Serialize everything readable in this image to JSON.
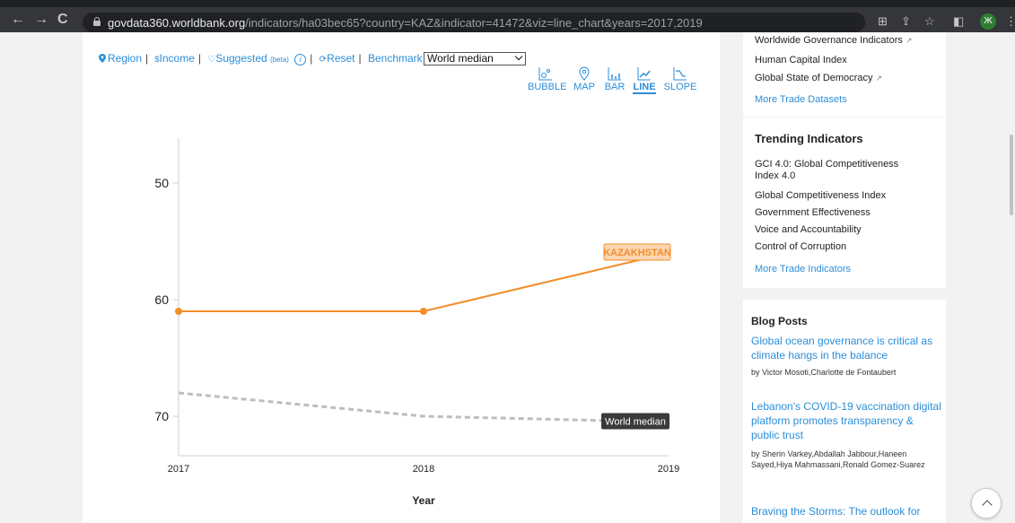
{
  "browser": {
    "url_domain": "govdata360.worldbank.org",
    "url_path": "/indicators/ha03bec65?country=KAZ&indicator=41472&viz=line_chart&years=2017,2019",
    "profile_initial": "Ж"
  },
  "filters": {
    "region": "Region",
    "income": "Income",
    "suggested": "Suggested",
    "beta": "(beta)",
    "info": "i",
    "reset": "Reset",
    "benchmark": "Benchmark",
    "benchmark_value": "World median"
  },
  "viz_tabs": [
    {
      "label": "BUBBLE",
      "icon": "bubble-chart-icon"
    },
    {
      "label": "MAP",
      "icon": "map-pin-icon"
    },
    {
      "label": "BAR",
      "icon": "bar-chart-icon"
    },
    {
      "label": "LINE",
      "icon": "line-chart-icon",
      "active": true
    },
    {
      "label": "SLOPE",
      "icon": "slope-chart-icon"
    }
  ],
  "chart_data": {
    "type": "line",
    "x": [
      2017,
      2018,
      2019
    ],
    "xlabel": "Year",
    "ylabel": "",
    "ylim": [
      76,
      48
    ],
    "y_reversed": true,
    "yticks": [
      50,
      60,
      70
    ],
    "series": [
      {
        "name": "KAZAKHSTAN",
        "values": [
          61,
          61,
          56
        ],
        "color": "#f28e2b",
        "style": "solid",
        "markers": true
      },
      {
        "name": "World median",
        "values": [
          68,
          70,
          70.5
        ],
        "color": "#bdbdbd",
        "style": "dashed",
        "markers": false
      }
    ]
  },
  "sidebar": {
    "datasets": [
      "Worldwide Governance Indicators",
      "Human Capital Index",
      "Global State of Democracy"
    ],
    "more_datasets": "More Trade Datasets",
    "trending_title": "Trending Indicators",
    "trending": [
      "GCI 4.0: Global Competitiveness Index 4.0",
      "Global Competitiveness Index",
      "Government Effectiveness",
      "Voice and Accountability",
      "Control of Corruption"
    ],
    "more_indicators": "More Trade Indicators",
    "blog_title": "Blog Posts",
    "posts": [
      {
        "title": "Global ocean governance is critical as climate hangs in the balance",
        "by": "by Victor Mosoti,Charlotte de Fontaubert"
      },
      {
        "title": "Lebanon's COVID-19 vaccination digital platform promotes transparency & public trust",
        "by": "by Sherin Varkey,Abdallah Jabbour,Haneen Sayed,Hiya Mahmassani,Ronald Gomez-Suarez"
      },
      {
        "title": "Braving the Storms: The outlook for",
        "by": ""
      }
    ]
  },
  "colors": {
    "accent": "#2b8ed8",
    "kazakhstan": "#f28e2b",
    "median": "#bdbdbd"
  }
}
